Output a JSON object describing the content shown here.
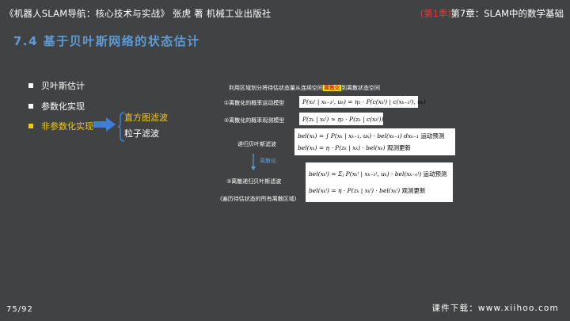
{
  "header": {
    "left": "《机器人SLAM导航：核心技术与实战》   张虎 著    机械工业出版社",
    "season": "(第1季)",
    "chapter": "第7章：SLAM中的数学基础"
  },
  "title": "7.4 基于贝叶斯网络的状态估计",
  "bullets": [
    {
      "label": "贝叶斯估计"
    },
    {
      "label": "参数化实现"
    },
    {
      "label": "非参数化实现"
    }
  ],
  "sub_items": [
    "直方图滤波",
    "粒子滤波"
  ],
  "diagram": {
    "intro_prefix": "利用区域划分将待估状态量从连续空间",
    "intro_highlight": "离散化",
    "intro_suffix": "到离散状态空间",
    "motion_label": "①离散化的概率运动模型",
    "motion_formula": "P(xₖⁱ | xₖ₋₁ʲ, uₖ) = η₁ · P(c(xₖⁱ) | c(xₖ₋₁ʲ), uₖ)",
    "observation_label": "②离散化的概率观测模型",
    "observation_formula": "P(zₖ | xₖⁱ) ≈ η₂ · P(zₖ | c(xₖⁱ))",
    "recursive_label": "递归贝叶斯滤波",
    "recursive_line1": "bel(xₖ) = ∫ P(xₖ | xₖ₋₁, uₖ) · bel(xₖ₋₁) dxₖ₋₁",
    "recursive_line1_tag": "运动预测",
    "recursive_line2": "bel(xₖ) = η · P(zₖ | xₖ) · bel(xₖ)",
    "recursive_line2_tag": "观测更新",
    "down_label": "离散化",
    "discrete_label": "③离散递归贝叶斯滤波",
    "discrete_note": "(遍历待估状态的所有离散区域)",
    "discrete_line1": "bel(xₖⁱ) = Σⱼ P(xₖⁱ | xₖ₋₁ʲ, uₖ) · bel(xₖ₋₁ʲ)",
    "discrete_line1_tag": "运动预测",
    "discrete_line2": "bel(xₖⁱ) = η · P(zₖ | xₖⁱ) · bel(xₖⁱ)",
    "discrete_line2_tag": "观测更新"
  },
  "footer": {
    "page": "75/92",
    "download": "课件下载：www.xiihoo.com"
  },
  "colors": {
    "background": "#414243",
    "title": "#5d9bd6",
    "active": "#f0c81e",
    "season": "#e03a3a",
    "arrow": "#3f7fd6",
    "highlight": "#f6f000"
  }
}
